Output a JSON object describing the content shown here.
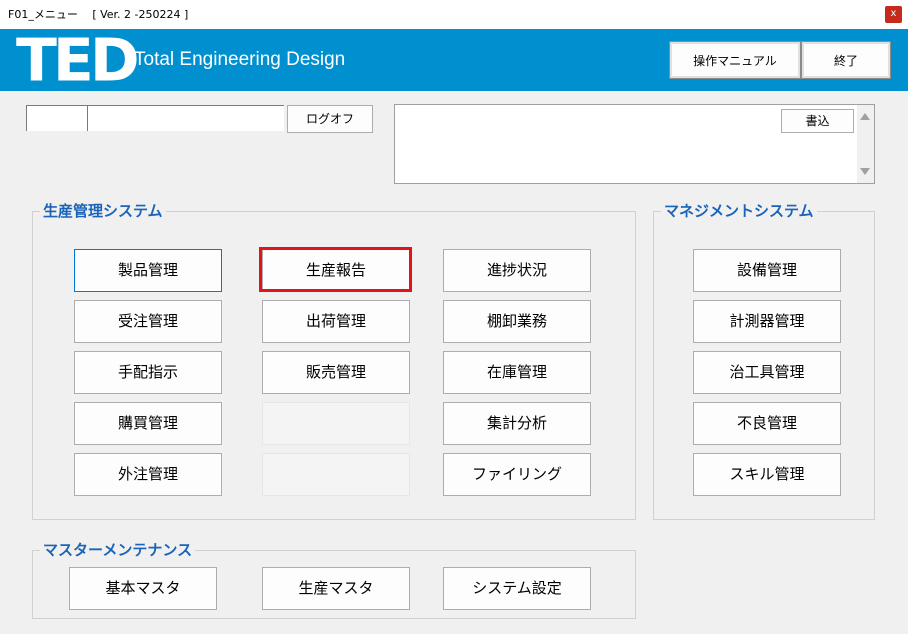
{
  "window": {
    "title": "F01_メニュー　 [ Ver. 2 -250224 ]",
    "close_label": "x"
  },
  "header": {
    "logo": "TED",
    "tagline": "Total Engineering Design",
    "manual_button": "操作マニュアル",
    "exit_button": "終了",
    "brand_color": "#0090cf"
  },
  "login": {
    "code_value": "",
    "name_value": "",
    "logoff_button": "ログオフ"
  },
  "memo": {
    "value": "",
    "write_button": "書込"
  },
  "production": {
    "label": "生産管理システム",
    "col1": [
      "製品管理",
      "受注管理",
      "手配指示",
      "購買管理",
      "外注管理"
    ],
    "col2": [
      "生産報告",
      "出荷管理",
      "販売管理"
    ],
    "col3": [
      "進捗状況",
      "棚卸業務",
      "在庫管理",
      "集計分析",
      "ファイリング"
    ]
  },
  "management": {
    "label": "マネジメントシステム",
    "items": [
      "設備管理",
      "計測器管理",
      "治工具管理",
      "不良管理",
      "スキル管理"
    ]
  },
  "master": {
    "label": "マスターメンテナンス",
    "items": [
      "基本マスタ",
      "生産マスタ",
      "システム設定"
    ]
  },
  "highlight_color": "#e0141b"
}
